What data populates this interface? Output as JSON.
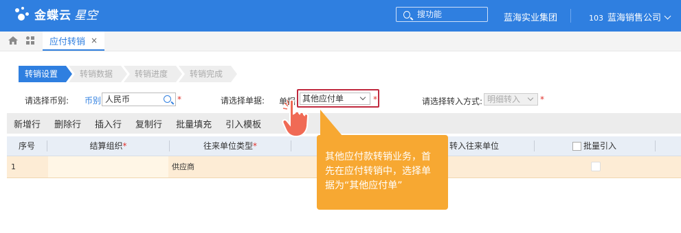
{
  "header": {
    "logo_text": "金蝶云",
    "logo_sub": "星空",
    "search_placeholder": "搜功能",
    "org": "蓝海实业集团",
    "company_id": "103",
    "company_name": "蓝海销售公司"
  },
  "tabs": [
    {
      "label": "应付转销",
      "close": "×"
    }
  ],
  "steps": [
    "转销设置",
    "转销数据",
    "转销进度",
    "转销完成"
  ],
  "form": {
    "currency_prompt": "请选择币别:",
    "currency_label": "币别",
    "currency_value": "人民币",
    "bill_prompt": "请选择单据:",
    "bill_label": "单据",
    "bill_value": "其他应付单",
    "mode_prompt": "请选择转入方式:",
    "mode_value": "明细转入",
    "required_mark": "*"
  },
  "toolbar": [
    "新增行",
    "删除行",
    "插入行",
    "复制行",
    "批量填充",
    "引入模板"
  ],
  "table": {
    "columns": {
      "seq": "序号",
      "settle_org": "结算组织",
      "contact_type": "往来单位类型",
      "target_unit": "转入往来单位",
      "batch_import": "批量引入"
    },
    "rows": [
      {
        "seq": "1",
        "contact_type": "供应商"
      }
    ]
  },
  "tooltip": {
    "text": "其他应付款转销业务，首先在应付转销中，选择单据为“其他应付单”"
  },
  "colors": {
    "brand": "#2f7fe0",
    "highlight_border": "#c0283d",
    "tooltip_bg": "#f7a832",
    "row_selected": "#fdecd5",
    "required": "#e0312b"
  }
}
